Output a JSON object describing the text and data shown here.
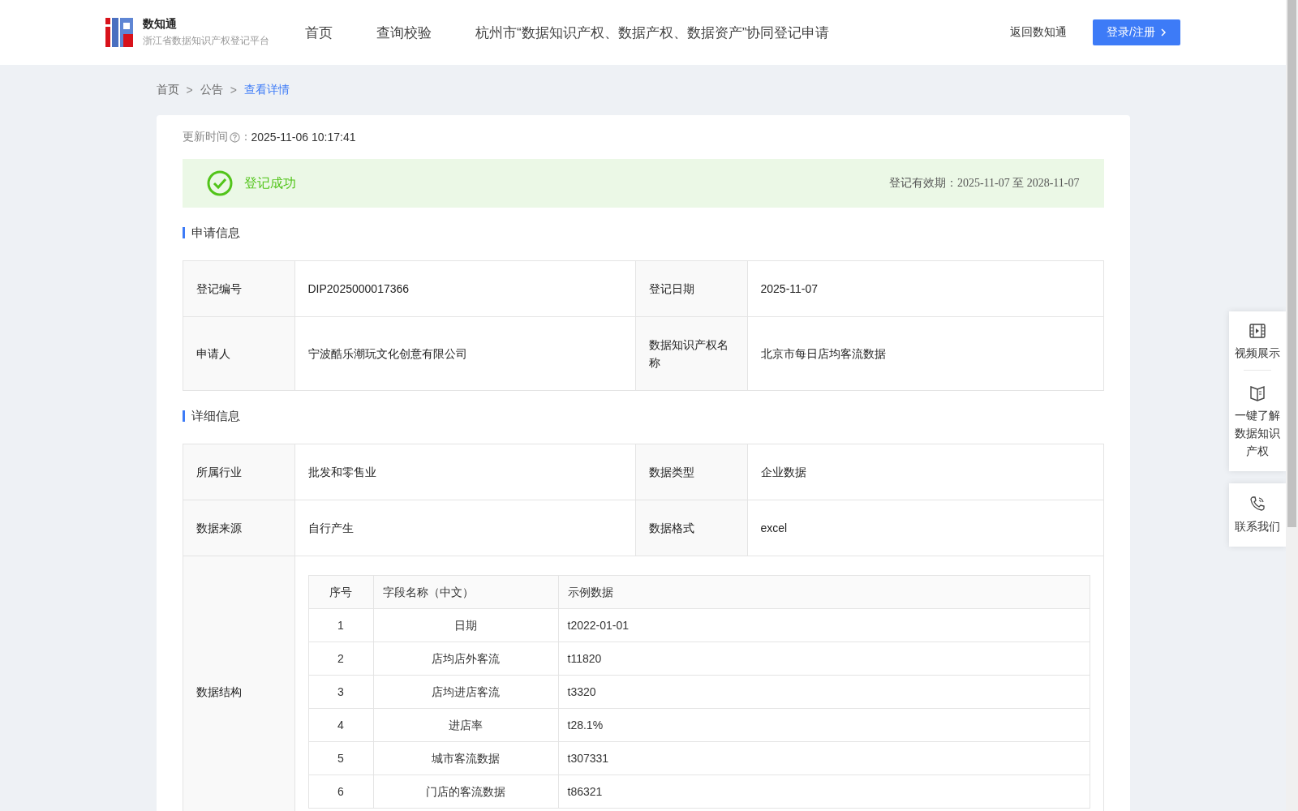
{
  "header": {
    "logo": {
      "name": "数知通",
      "subtitle": "浙江省数据知识产权登记平台"
    },
    "nav": [
      {
        "label": "首页"
      },
      {
        "label": "查询校验"
      },
      {
        "label": "杭州市“数据知识产权、数据产权、数据资产”协同登记申请"
      }
    ],
    "back_link": "返回数知通",
    "login_button": "登录/注册"
  },
  "breadcrumb": [
    {
      "label": "首页",
      "current": false
    },
    {
      "label": "公告",
      "current": false,
      "separator": ">"
    },
    {
      "label": "查看详情",
      "current": true,
      "separator": ">"
    }
  ],
  "update": {
    "label": "更新时间",
    "separator": "：",
    "value": "2025-11-06 10:17:41"
  },
  "status": {
    "text": "登记成功",
    "validity_label": "登记有效期：",
    "validity_value": "2025-11-07 至 2028-11-07"
  },
  "sections": [
    {
      "title": "申请信息",
      "rows": [
        {
          "kind": "pairs",
          "cells": [
            {
              "label": "登记编号",
              "value": "DIP2025000017366"
            },
            {
              "label": "登记日期",
              "value": "2025-11-07"
            }
          ]
        },
        {
          "kind": "pairs",
          "cells": [
            {
              "label": "申请人",
              "value": "宁波酷乐潮玩文化创意有限公司"
            },
            {
              "label": "数据知识产权名称",
              "value": "北京市每日店均客流数据"
            }
          ]
        }
      ]
    },
    {
      "title": "详细信息",
      "rows": [
        {
          "kind": "pairs",
          "cells": [
            {
              "label": "所属行业",
              "value": "批发和零售业"
            },
            {
              "label": "数据类型",
              "value": "企业数据"
            }
          ]
        },
        {
          "kind": "pairs",
          "cells": [
            {
              "label": "数据来源",
              "value": "自行产生"
            },
            {
              "label": "数据格式",
              "value": "excel"
            }
          ]
        },
        {
          "kind": "structure",
          "label": "数据结构",
          "columns": [
            "序号",
            "字段名称（中文）",
            "示例数据"
          ],
          "rows": [
            [
              "1",
              "日期",
              "t2022-01-01"
            ],
            [
              "2",
              "店均店外客流",
              "t11820"
            ],
            [
              "3",
              "店均进店客流",
              "t3320"
            ],
            [
              "4",
              "进店率",
              "t28.1%"
            ],
            [
              "5",
              "城市客流数据",
              "t307331"
            ],
            [
              "6",
              "门店的客流数据",
              "t86321"
            ]
          ]
        }
      ]
    }
  ],
  "side_panel": [
    {
      "kind": "video",
      "label": "视频展示"
    },
    {
      "kind": "book",
      "label": "一键了解数据知识产权"
    },
    {
      "kind": "phone",
      "label": "联系我们"
    }
  ]
}
